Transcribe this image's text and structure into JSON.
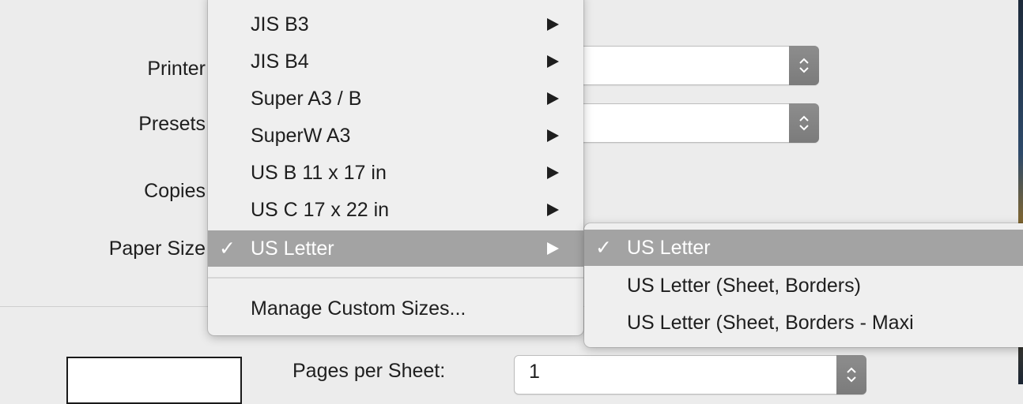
{
  "form": {
    "printer_label": "Printer",
    "presets_label": "Presets",
    "copies_label": "Copies",
    "paper_size_label": "Paper Size"
  },
  "layout": {
    "pages_per_sheet_label": "Pages per Sheet:",
    "pages_per_sheet_value": "1"
  },
  "paper_menu": {
    "items": [
      {
        "label": "JIS B3",
        "has_submenu": true,
        "checked": false
      },
      {
        "label": "JIS B4",
        "has_submenu": true,
        "checked": false
      },
      {
        "label": "Super A3 / B",
        "has_submenu": true,
        "checked": false
      },
      {
        "label": "SuperW A3",
        "has_submenu": true,
        "checked": false
      },
      {
        "label": "US B 11 x 17 in",
        "has_submenu": true,
        "checked": false
      },
      {
        "label": "US C 17 x 22 in",
        "has_submenu": true,
        "checked": false
      },
      {
        "label": "US Letter",
        "has_submenu": true,
        "checked": true,
        "check_mark": "✓"
      }
    ],
    "manage_label": "Manage Custom Sizes..."
  },
  "paper_submenu": {
    "items": [
      {
        "label": "US Letter",
        "checked": true,
        "check_mark": "✓"
      },
      {
        "label": "US Letter (Sheet, Borders)",
        "checked": false
      },
      {
        "label": "US Letter (Sheet, Borders - Maxi",
        "checked": false
      }
    ]
  },
  "colors": {
    "highlight": "#a3a3a3",
    "stepper": "#808080",
    "window_bg": "#ececec"
  }
}
